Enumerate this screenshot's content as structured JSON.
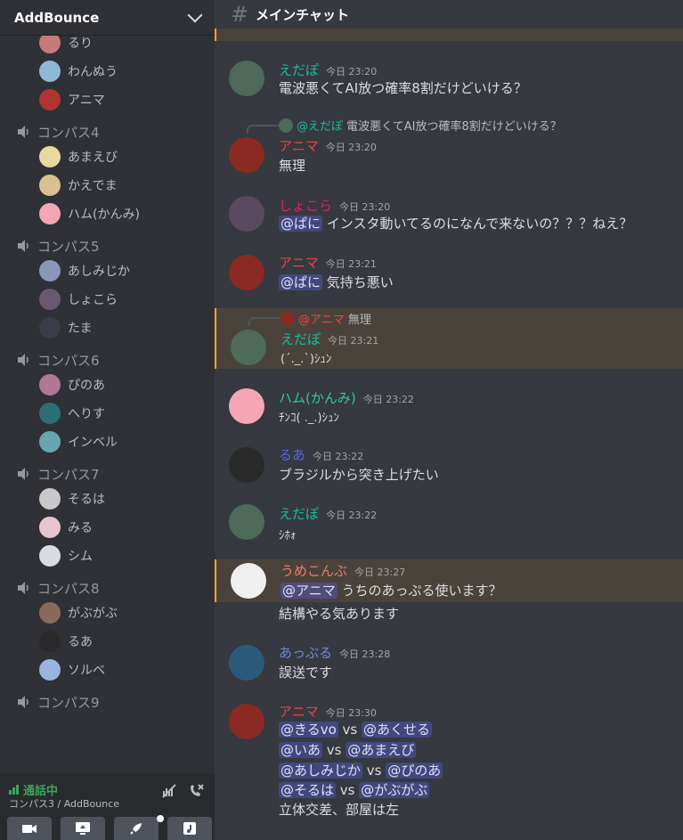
{
  "server": {
    "name": "AddBounce"
  },
  "sidebar": {
    "top_users": [
      {
        "name": "るり",
        "color": "#c77a7a"
      },
      {
        "name": "わんぬう",
        "color": "#8fb8d8"
      },
      {
        "name": "アニマ",
        "color": "#b0352e"
      }
    ],
    "channels": [
      {
        "name": "コンパス4",
        "users": [
          {
            "name": "あまえび",
            "color": "#e8d9a0"
          },
          {
            "name": "かえでま",
            "color": "#d8c090"
          },
          {
            "name": "ハム(かんみ)",
            "color": "#f4a6b5"
          }
        ]
      },
      {
        "name": "コンパス5",
        "users": [
          {
            "name": "あしみじか",
            "color": "#8a97b8"
          },
          {
            "name": "しょこら",
            "color": "#6a5870"
          },
          {
            "name": "たま",
            "color": "#3c3c48"
          }
        ]
      },
      {
        "name": "コンパス6",
        "users": [
          {
            "name": "ぴのあ",
            "color": "#b07896"
          },
          {
            "name": "へりす",
            "color": "#2d6f74"
          },
          {
            "name": "インベル",
            "color": "#6aa4b0"
          }
        ]
      },
      {
        "name": "コンパス7",
        "users": [
          {
            "name": "そるは",
            "color": "#c8c8c8"
          },
          {
            "name": "みる",
            "color": "#e6c6ce"
          },
          {
            "name": "シム",
            "color": "#d6dbe4"
          }
        ]
      },
      {
        "name": "コンパス8",
        "users": [
          {
            "name": "がぶがぶ",
            "color": "#8a6a5a"
          },
          {
            "name": "るあ",
            "color": "#2a2a2a"
          },
          {
            "name": "ソルベ",
            "color": "#9ab4e0"
          }
        ]
      },
      {
        "name": "コンパス9",
        "users": []
      }
    ]
  },
  "voice_panel": {
    "status": "通話中",
    "location": "コンパス3 / AddBounce"
  },
  "channel": {
    "name": "メインチャット"
  },
  "messages": [
    {
      "author": "えだぽ",
      "time": "今日 23:20",
      "text": "電波悪くてAI放つ確率8割だけどいける？"
    },
    {
      "reply_author": "@えだぽ",
      "reply_text": "電波悪くてAI放つ確率8割だけどいける？",
      "author": "アニマ",
      "time": "今日 23:20",
      "text": "無理"
    },
    {
      "author": "しょこら",
      "time": "今日 23:20",
      "mention": "@ぱに",
      "text": " インスタ動いてるのになんで来ないの？？？ねえ？"
    },
    {
      "author": "アニマ",
      "time": "今日 23:21",
      "mention": "@ぱに",
      "text": " 気持ち悪い"
    },
    {
      "reply_author": "@アニマ",
      "reply_text": "無理",
      "author": "えだぽ",
      "time": "今日 23:21",
      "text": "(´._.`)ｼｭﾝ"
    },
    {
      "author": "ハム(かんみ)",
      "time": "今日 23:22",
      "text": "ﾁﾝｺ( ._.)ｼｭﾝ"
    },
    {
      "author": "るあ",
      "time": "今日 23:22",
      "text": "ブラジルから突き上げたい"
    },
    {
      "author": "えだぽ",
      "time": "今日 23:22",
      "text": "ｼﾎｫ"
    },
    {
      "author": "うめこんぶ",
      "time": "今日 23:27",
      "mention": "@アニマ",
      "text": " うちのあっぷる使います？",
      "line2": "結構やる気あります"
    },
    {
      "author": "あっぷる",
      "time": "今日 23:28",
      "text": "誤送です"
    },
    {
      "author": "アニマ",
      "time": "今日 23:30",
      "pairs": [
        {
          "a": "@きるvo",
          "b": "@あくせる"
        },
        {
          "a": "@いあ",
          "b": "@あまえび"
        },
        {
          "a": "@あしみじか",
          "b": "@ぴのあ"
        },
        {
          "a": "@そるは",
          "b": "@がぶがぶ"
        }
      ],
      "vs": "vs",
      "footer": "立体交差、部屋は左"
    }
  ],
  "colors": {
    "anima": "#ed4245",
    "edapo": "#1abc9c",
    "shokora": "#e91e63",
    "hamu": "#2ecc9c",
    "rua": "#5865f2",
    "umekonbu": "#f47b67",
    "appuru": "#7289da"
  }
}
